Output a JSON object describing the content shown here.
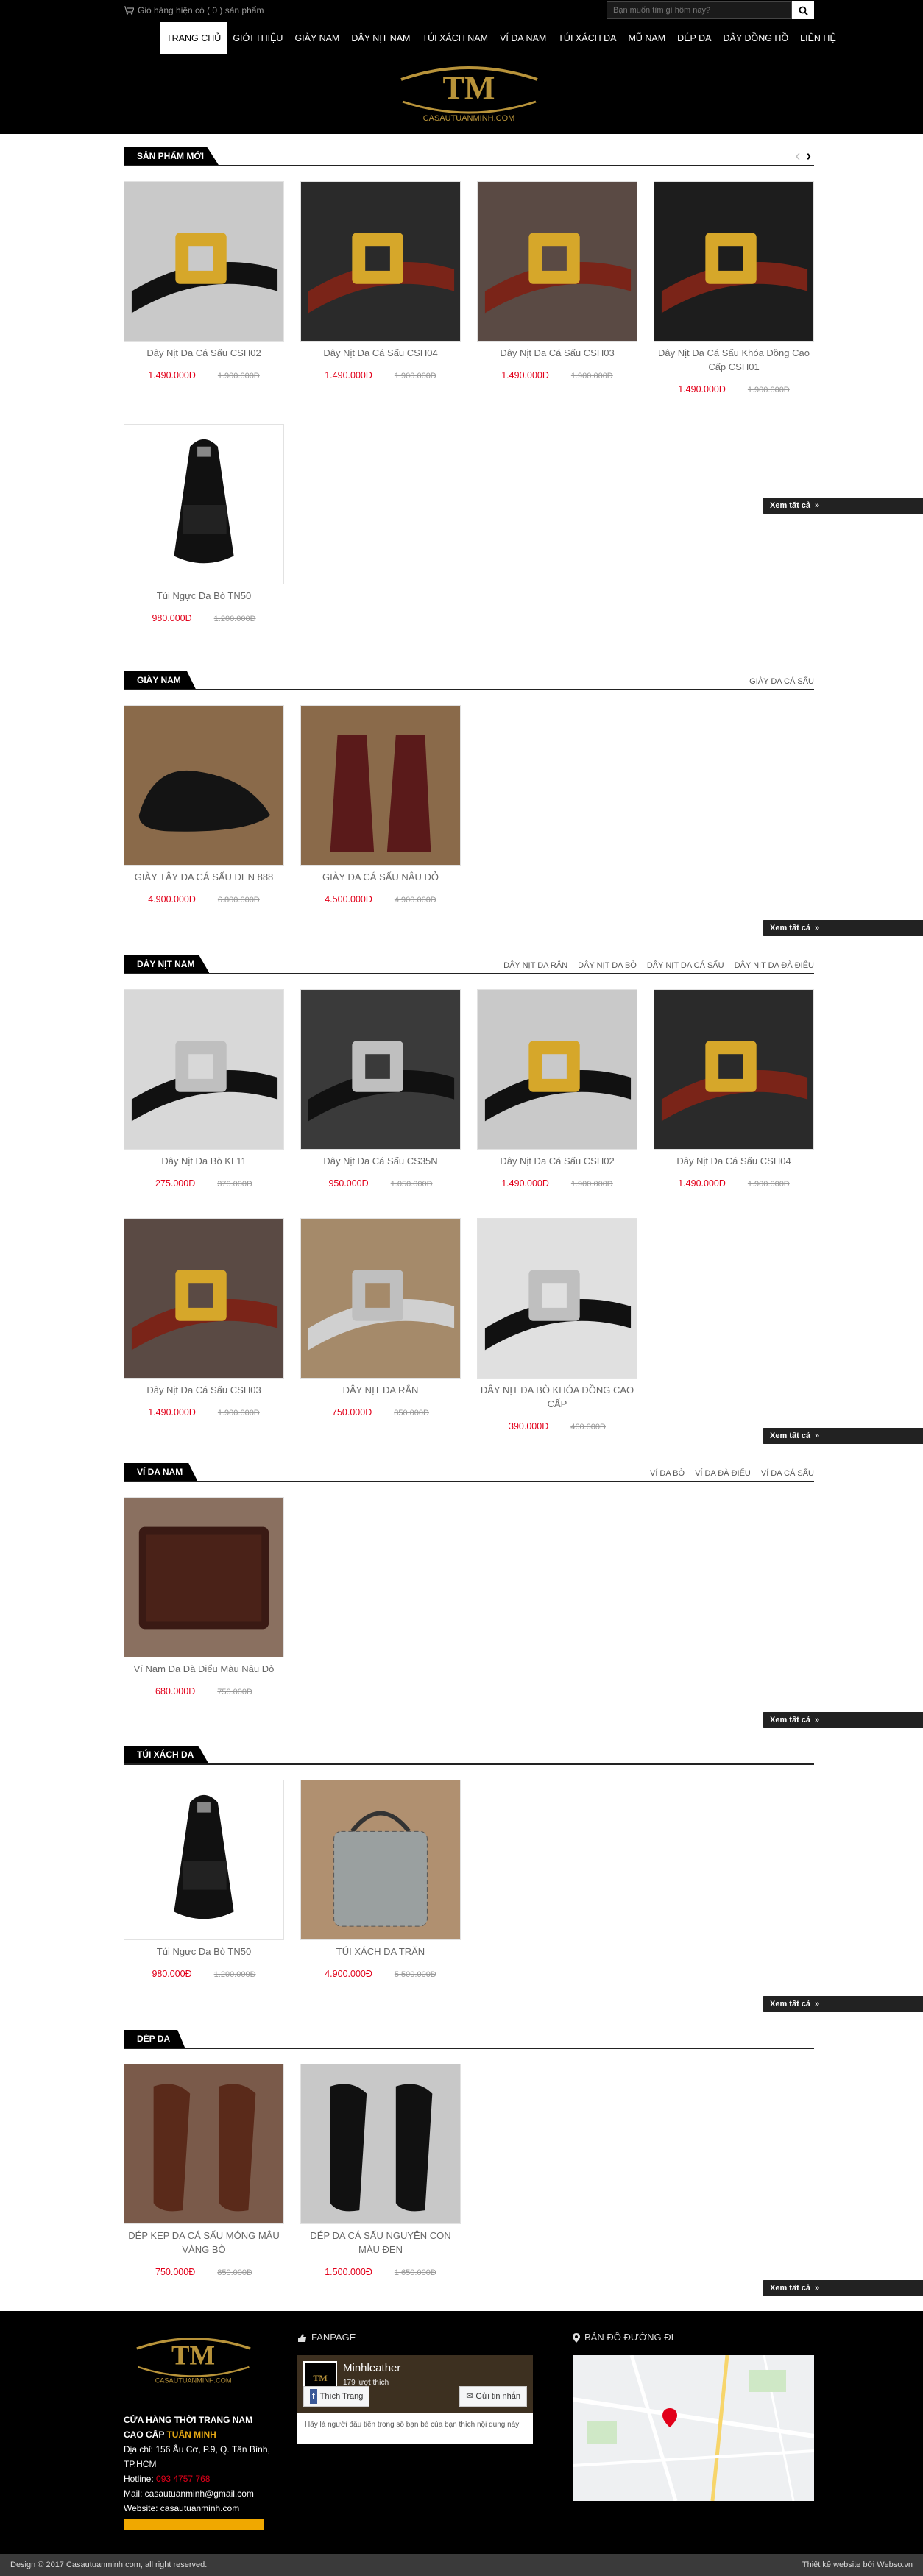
{
  "topbar": {
    "cart_text": "Giỏ hàng hiện có ( 0 ) sản phẩm"
  },
  "search": {
    "placeholder": "Bạn muốn tìm gì hôm nay?"
  },
  "nav": [
    "TRANG CHỦ",
    "GIỚI THIỆU",
    "GIÀY NAM",
    "DÂY NỊT NAM",
    "TÚI XÁCH NAM",
    "VÍ DA NAM",
    "TÚI XÁCH DA",
    "MŨ NAM",
    "DÉP DA",
    "DÂY ĐỒNG HỒ",
    "LIÊN HỆ"
  ],
  "logo": {
    "mark": "TM",
    "text": "CASAUTUANMINH.COM"
  },
  "more_label": "Xem tất cả",
  "sections": [
    {
      "title": "SẢN PHẨM MỚI",
      "links": [],
      "products": [
        {
          "name": "Dây Nịt Da Cá Sấu CSH02",
          "price": "1.490.000Đ",
          "old": "1.900.000Đ",
          "img": "belt-h"
        },
        {
          "name": "Dây Nịt Da Cá Sấu CSH04",
          "price": "1.490.000Đ",
          "old": "1.900.000Đ",
          "img": "belt-croc-box"
        },
        {
          "name": "Dây Nịt Da Cá Sấu CSH03",
          "price": "1.490.000Đ",
          "old": "1.900.000Đ",
          "img": "belt-h-red"
        },
        {
          "name": "Dây Nịt Da Cá Sấu Khóa Đồng Cao Cấp CSH01",
          "price": "1.490.000Đ",
          "old": "1.900.000Đ",
          "img": "belt-h-box"
        },
        {
          "name": "Túi Ngực Da Bò TN50",
          "price": "980.000Đ",
          "old": "1.200.000Đ",
          "img": "bag"
        }
      ]
    },
    {
      "title": "GIÀY NAM",
      "links": [
        "GIÀY DA CÁ SẤU"
      ],
      "products": [
        {
          "name": "GIÀY TÂY DA CÁ SẤU ĐEN 888",
          "price": "4.900.000Đ",
          "old": "6.800.000Đ",
          "img": "shoe-black"
        },
        {
          "name": "GIÀY DA CÁ SẤU NÂU ĐỎ",
          "price": "4.500.000Đ",
          "old": "4.900.000Đ",
          "img": "shoe-red"
        }
      ]
    },
    {
      "title": "DÂY NỊT NAM",
      "links": [
        "DÂY NỊT DA RẮN",
        "DÂY NỊT DA BÒ",
        "DÂY NỊT DA CÁ SẤU",
        "DÂY NỊT DA ĐÀ ĐIỂU"
      ],
      "products": [
        {
          "name": "Dây Nịt Da Bò KL11",
          "price": "275.000Đ",
          "old": "370.000Đ",
          "img": "belt-black"
        },
        {
          "name": "Dây Nịt Da Cá Sấu CS35N",
          "price": "950.000Đ",
          "old": "1.050.000Đ",
          "img": "belt-black2"
        },
        {
          "name": "Dây Nịt Da Cá Sấu CSH02",
          "price": "1.490.000Đ",
          "old": "1.900.000Đ",
          "img": "belt-h"
        },
        {
          "name": "Dây Nịt Da Cá Sấu CSH04",
          "price": "1.490.000Đ",
          "old": "1.900.000Đ",
          "img": "belt-croc-box"
        },
        {
          "name": "Dây Nịt Da Cá Sấu CSH03",
          "price": "1.490.000Đ",
          "old": "1.900.000Đ",
          "img": "belt-h-red"
        },
        {
          "name": "DÂY NỊT DA RẮN",
          "price": "750.000Đ",
          "old": "850.000Đ",
          "img": "belt-snake"
        },
        {
          "name": "DÂY NỊT DA BÒ KHÓA ĐỒNG CAO CẤP",
          "price": "390.000Đ",
          "old": "460.000Đ",
          "img": "belt-g"
        }
      ]
    },
    {
      "title": "VÍ DA NAM",
      "links": [
        "VÍ DA BÒ",
        "VÍ DA ĐÀ ĐIỂU",
        "VÍ DA CÁ SẤU"
      ],
      "products": [
        {
          "name": "Ví Nam Da Đà Điểu Màu Nâu Đỏ",
          "price": "680.000Đ",
          "old": "750.000Đ",
          "img": "wallet"
        }
      ]
    },
    {
      "title": "TÚI XÁCH DA",
      "links": [],
      "products": [
        {
          "name": "Túi Ngực Da Bò TN50",
          "price": "980.000Đ",
          "old": "1.200.000Đ",
          "img": "bag"
        },
        {
          "name": "TÚI XÁCH DA TRĂN",
          "price": "4.900.000Đ",
          "old": "5.500.000Đ",
          "img": "python-bag"
        }
      ]
    },
    {
      "title": "DÉP DA",
      "links": [],
      "products": [
        {
          "name": "DÉP KẸP DA CÁ SẤU MÓNG MÂU VÀNG BÒ",
          "price": "750.000Đ",
          "old": "850.000Đ",
          "img": "sandal-brown"
        },
        {
          "name": "DÉP DA CÁ SẤU NGUYÊN CON MÀU ĐEN",
          "price": "1.500.000Đ",
          "old": "1.650.000Đ",
          "img": "sandal-black"
        }
      ]
    }
  ],
  "footer": {
    "store_title": "CỬA HÀNG THỜI TRANG NAM",
    "store_sub": "CAO CẤP",
    "store_brand": "TUẤN MINH",
    "address": "Địa chỉ: 156 Âu Cơ, P.9, Q. Tân Bình, TP.HCM",
    "hotline_label": "Hotline:",
    "hotline": "093 4757 768",
    "mail": "Mail: casautuanminh@gmail.com",
    "website": "Website: casautuanminh.com",
    "fanpage_title": "FANPAGE",
    "fb_name": "Minhleather",
    "fb_likes": "179 lượt thích",
    "fb_like_btn": "Thích Trang",
    "fb_msg_btn": "Gửi tin nhắn",
    "fb_note": "Hãy là người đầu tiên trong số bạn bè của bạn thích nội dung này",
    "map_title": "BẢN ĐỒ ĐƯỜNG ĐI",
    "copyright": "Design © 2017 Casautuanminh.com, all right reserved.",
    "credit": "Thiết kế website bởi Webso.vn"
  }
}
